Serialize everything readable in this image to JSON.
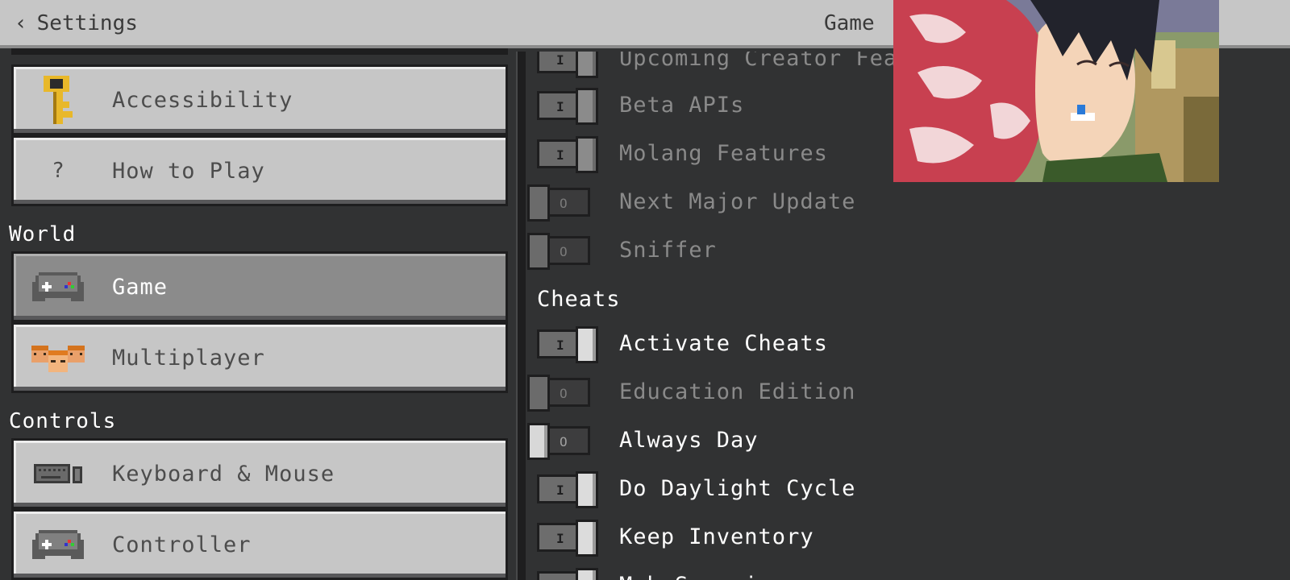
{
  "header": {
    "back_label": "Settings",
    "title": "Game"
  },
  "left": {
    "top_items": [
      {
        "label": "Accessibility",
        "icon": "key-icon"
      },
      {
        "label": "How to Play",
        "icon": "question-icon"
      }
    ],
    "world_heading": "World",
    "world_items": [
      {
        "label": "Game",
        "icon": "gamepad-icon",
        "active": true
      },
      {
        "label": "Multiplayer",
        "icon": "players-icon"
      }
    ],
    "controls_heading": "Controls",
    "controls_items": [
      {
        "label": "Keyboard & Mouse",
        "icon": "keyboard-icon"
      },
      {
        "label": "Controller",
        "icon": "gamepad-icon"
      }
    ]
  },
  "right": {
    "experiments": [
      {
        "label": "Upcoming Creator Features",
        "state": "on",
        "disabled": true
      },
      {
        "label": "Beta APIs",
        "state": "on",
        "disabled": true
      },
      {
        "label": "Molang Features",
        "state": "on",
        "disabled": true
      },
      {
        "label": "Next Major Update",
        "state": "off",
        "disabled": true
      },
      {
        "label": "Sniffer",
        "state": "off",
        "disabled": true
      }
    ],
    "cheats_heading": "Cheats",
    "cheats": [
      {
        "label": "Activate Cheats",
        "state": "on",
        "disabled": false
      },
      {
        "label": "Education Edition",
        "state": "off",
        "disabled": true
      },
      {
        "label": "Always Day",
        "state": "off",
        "disabled": false
      },
      {
        "label": "Do Daylight Cycle",
        "state": "on",
        "disabled": false
      },
      {
        "label": "Keep Inventory",
        "state": "on",
        "disabled": false
      },
      {
        "label": "Mob Spawning",
        "state": "on",
        "disabled": false
      }
    ],
    "toggle_on_mark": "I",
    "toggle_off_mark": "O"
  },
  "colors": {
    "panel_bg": "#313233",
    "button_bg": "#c6c6c6",
    "active_bg": "#8b8b8b"
  }
}
